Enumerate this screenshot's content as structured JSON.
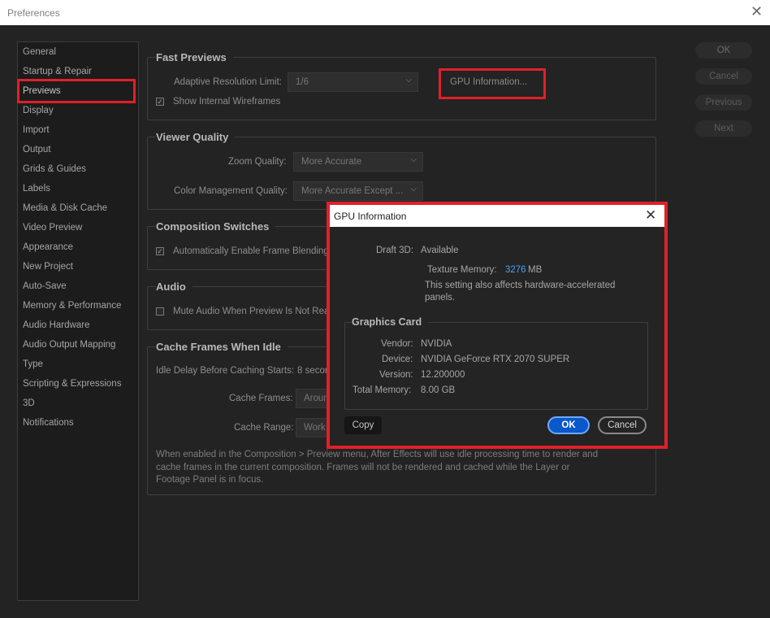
{
  "window": {
    "title": "Preferences",
    "close_icon": "close-icon"
  },
  "sidebar": {
    "items": [
      "General",
      "Startup & Repair",
      "Previews",
      "Display",
      "Import",
      "Output",
      "Grids & Guides",
      "Labels",
      "Media & Disk Cache",
      "Video Preview",
      "Appearance",
      "New Project",
      "Auto-Save",
      "Memory & Performance",
      "Audio Hardware",
      "Audio Output Mapping",
      "Type",
      "Scripting & Expressions",
      "3D",
      "Notifications"
    ],
    "selected": "Previews"
  },
  "fast_previews": {
    "title": "Fast Previews",
    "adaptive_label": "Adaptive Resolution Limit:",
    "adaptive_value": "1/6",
    "gpu_button": "GPU Information...",
    "wireframes_label": "Show Internal Wireframes",
    "wireframes_checked": true
  },
  "viewer_quality": {
    "title": "Viewer Quality",
    "zoom_label": "Zoom Quality:",
    "zoom_value": "More Accurate",
    "color_label": "Color Management Quality:",
    "color_value": "More Accurate Except ..."
  },
  "composition_switches": {
    "title": "Composition Switches",
    "frame_blending_label": "Automatically Enable Frame Blending",
    "frame_blending_checked": true
  },
  "audio": {
    "title": "Audio",
    "mute_label": "Mute Audio When Preview Is Not Real",
    "mute_checked": false
  },
  "cache_frames": {
    "title": "Cache Frames When Idle",
    "idle_delay_label": "Idle Delay Before Caching Starts:",
    "idle_delay_value": "8 secon",
    "cache_frames_label": "Cache Frames:",
    "cache_frames_value": "Aroun",
    "cache_range_label": "Cache Range:",
    "cache_range_value": "Work",
    "description": "When enabled in the Composition > Preview menu, After Effects will use idle processing time to render and cache frames in the current composition. Frames will not be rendered and cached while the Layer or Footage Panel is in focus."
  },
  "right_buttons": {
    "ok": "OK",
    "cancel": "Cancel",
    "previous": "Previous",
    "next": "Next"
  },
  "gpu_dialog": {
    "title": "GPU Information",
    "draft3d_label": "Draft 3D:",
    "draft3d_value": "Available",
    "texture_label": "Texture Memory:",
    "texture_value": "3276",
    "texture_unit": "MB",
    "note": "This setting also affects hardware-accelerated panels.",
    "graphics_card": {
      "title": "Graphics Card",
      "vendor_label": "Vendor:",
      "vendor_value": "NVIDIA",
      "device_label": "Device:",
      "device_value": "NVIDIA GeForce RTX 2070 SUPER",
      "version_label": "Version:",
      "version_value": "12.200000",
      "memory_label": "Total Memory:",
      "memory_value": "8.00 GB"
    },
    "copy_button": "Copy",
    "ok_button": "OK",
    "cancel_button": "Cancel"
  },
  "colors": {
    "highlight_red": "#e0202a",
    "accent_blue": "#0a58c9",
    "link_blue": "#4a9ff0"
  }
}
